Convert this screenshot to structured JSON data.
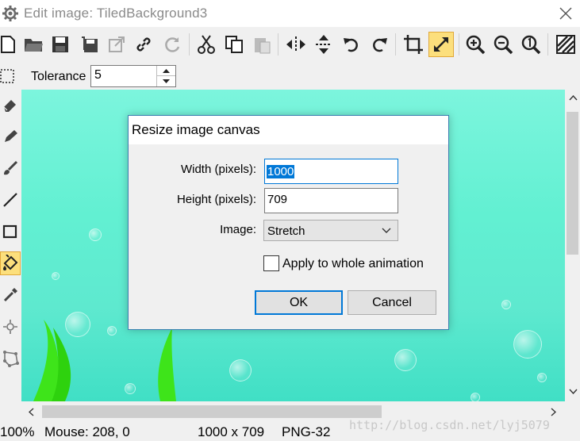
{
  "window": {
    "title": "Edit image: TiledBackground3",
    "app_icon": "gear-icon",
    "close_icon": "close-icon"
  },
  "toolbar": {
    "buttons": [
      "new-icon",
      "open-folder-icon",
      "save-icon",
      "save-as-icon",
      "export-icon",
      "link-icon",
      "refresh-icon",
      "cut-icon",
      "copy-icon",
      "paste-icon",
      "flip-horizontal-icon",
      "flip-vertical-icon",
      "rotate-left-icon",
      "rotate-right-icon",
      "crop-icon",
      "resize-icon",
      "zoom-in-icon",
      "zoom-out-icon",
      "zoom-reset-icon",
      "transparency-grid-icon"
    ],
    "active": "resize-icon"
  },
  "options": {
    "tolerance_label": "Tolerance",
    "tolerance_value": "5"
  },
  "left_tools": [
    "selection-icon",
    "eraser-icon",
    "pencil-icon",
    "brush-icon",
    "line-icon",
    "rectangle-icon",
    "fill-bucket-icon",
    "eyedropper-icon",
    "magic-wand-icon",
    "polygon-select-icon"
  ],
  "left_tools_active": "fill-bucket-icon",
  "dialog": {
    "title": "Resize image canvas",
    "width_label": "Width (pixels):",
    "width_value": "1000",
    "height_label": "Height (pixels):",
    "height_value": "709",
    "image_label": "Image:",
    "image_option": "Stretch",
    "apply_label": "Apply to whole animation",
    "apply_checked": false,
    "ok_label": "OK",
    "cancel_label": "Cancel"
  },
  "status": {
    "zoom": "100%",
    "mouse": "Mouse: 208, 0",
    "size": "1000 x 709",
    "format": "PNG-32",
    "watermark": "http://blog.csdn.net/lyj5079"
  },
  "colors": {
    "accent": "#0078d7",
    "active_tool": "#fcdf7c",
    "canvas_top": "#7cf5dd",
    "canvas_bottom": "#40dfc5",
    "seaweed": "#3ee41a"
  }
}
